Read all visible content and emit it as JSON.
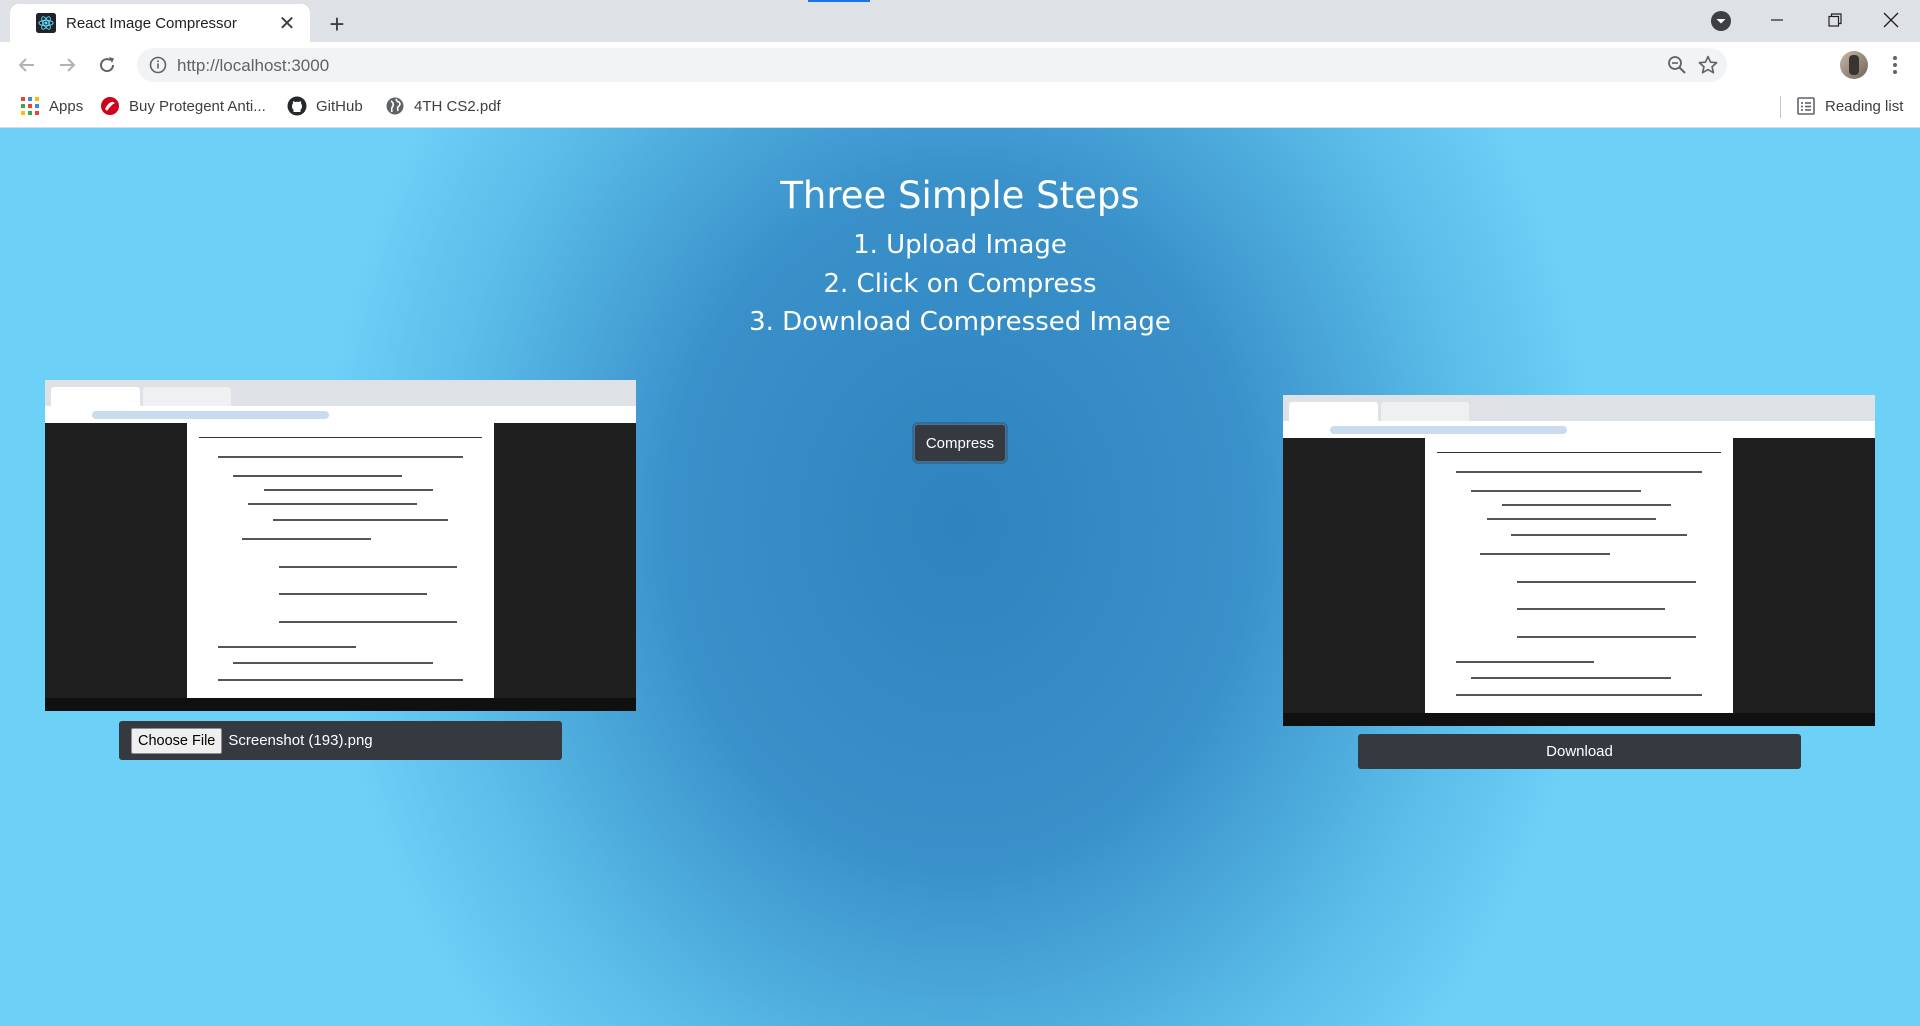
{
  "browser": {
    "tab_title": "React Image Compressor",
    "url": "http://localhost:3000",
    "bookmarks": [
      {
        "label": "Apps",
        "icon": "apps-grid-icon"
      },
      {
        "label": "Buy Protegent Anti...",
        "icon": "protegent-icon"
      },
      {
        "label": "GitHub",
        "icon": "github-icon"
      },
      {
        "label": "4TH CS2.pdf",
        "icon": "globe-icon"
      }
    ],
    "reading_list": "Reading list"
  },
  "page": {
    "heading": "Three Simple Steps",
    "steps": [
      "1. Upload Image",
      "2. Click on Compress",
      "3. Download Compressed Image"
    ],
    "compress_label": "Compress",
    "choose_file_label": "Choose File",
    "file_name": "Screenshot (193).png",
    "download_label": "Download"
  },
  "colors": {
    "page_gradient_center": "#2f83be",
    "page_gradient_edge": "#6cd0f7",
    "button_dark": "#343a40"
  }
}
